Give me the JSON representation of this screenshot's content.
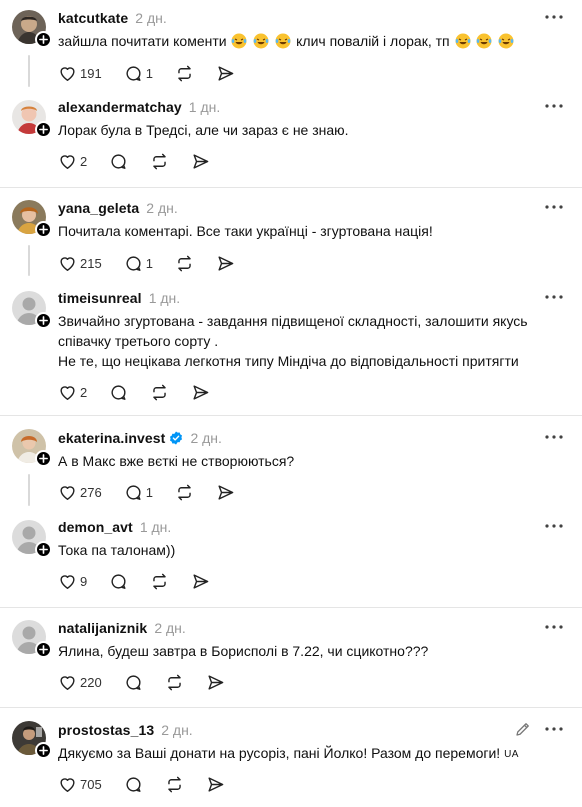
{
  "posts": [
    {
      "user": "katcutkate",
      "time": "2 дн.",
      "text": "зайшла почитати коменти",
      "text2": "клич повалій і лорак, тп",
      "likes": "191",
      "replies": "1"
    },
    {
      "user": "alexandermatchay",
      "time": "1 дн.",
      "text": "Лорак була в Тредсі, але чи зараз є не знаю.",
      "likes": "2",
      "replies": ""
    },
    {
      "user": "yana_geleta",
      "time": "2 дн.",
      "text": "Почитала коментарі. Все таки українці - згуртована нація!",
      "likes": "215",
      "replies": "1"
    },
    {
      "user": "timeisunreal",
      "time": "1 дн.",
      "text": "Звичайно згуртована - завдання підвищеної складності, залошити якусь співачку третього сорту .",
      "text2": "Не те, що нецікава легкотня типу Міндіча до відповідальності притягти",
      "likes": "2",
      "replies": ""
    },
    {
      "user": "ekaterina.invest",
      "time": "2 дн.",
      "text": "А в Макс вже вєткі не створюються?",
      "likes": "276",
      "replies": "1"
    },
    {
      "user": "demon_avt",
      "time": "1 дн.",
      "text": "Тока па талонам))",
      "likes": "9",
      "replies": ""
    },
    {
      "user": "natalijaniznik",
      "time": "2 дн.",
      "text": "Ялина, будеш завтра в Борисполі в 7.22, чи сцикотно???",
      "likes": "220",
      "replies": ""
    },
    {
      "user": "prostostas_13",
      "time": "2 дн.",
      "text": "Дякуємо за Ваші донати на русоріз, пані Йолко! Разом до перемоги!",
      "text_flag": "UA",
      "likes": "705",
      "replies": ""
    }
  ],
  "icons": {
    "like": "heart-icon",
    "reply": "comment-icon",
    "repost": "repost-icon",
    "share": "send-icon",
    "more": "more-dots-icon",
    "follow": "plus-icon",
    "verified": "verified-badge-icon",
    "edit": "pencil-icon",
    "emoji": "rofl-emoji-icon"
  },
  "colors": {
    "text": "#101010",
    "muted": "#999999",
    "divider": "#e5e5e5",
    "verified": "#0095f6"
  }
}
